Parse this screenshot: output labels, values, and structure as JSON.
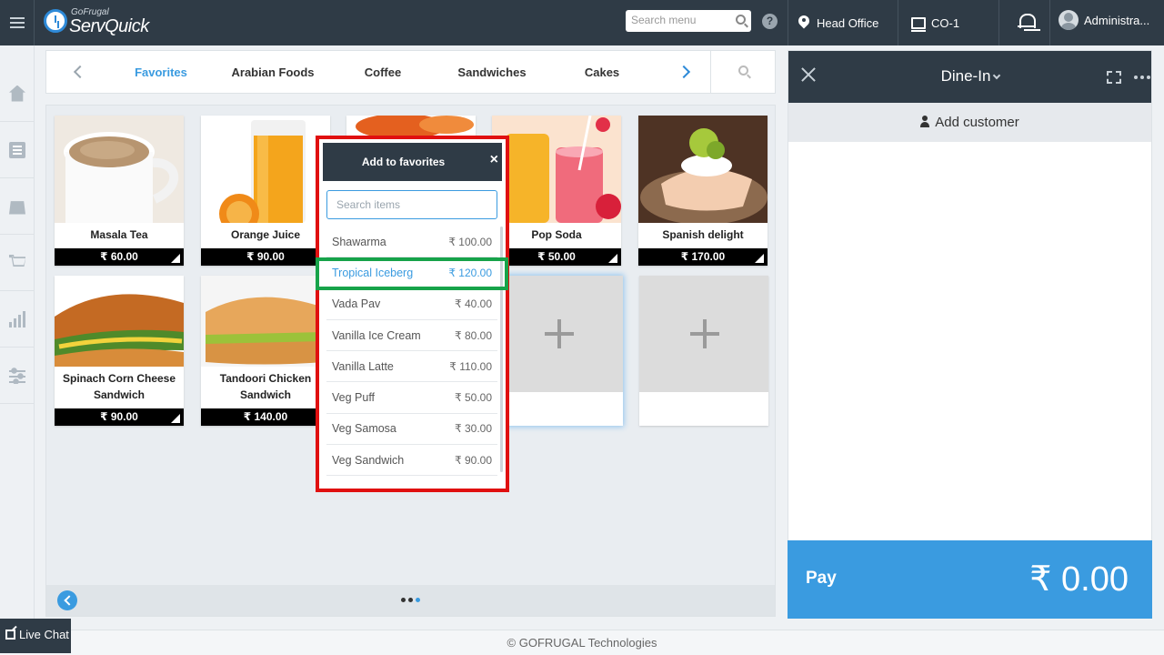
{
  "topbar": {
    "brand_small": "GoFrugal",
    "brand_big": "ServQuick",
    "search_placeholder": "Search menu",
    "location": "Head Office",
    "counter": "CO-1",
    "user": "Administra..."
  },
  "categories": {
    "items": [
      "Favorites",
      "Arabian Foods",
      "Coffee",
      "Sandwiches",
      "Cakes"
    ],
    "active": "Favorites"
  },
  "favorites": [
    {
      "name": "Masala Tea",
      "price": "₹ 60.00"
    },
    {
      "name": "Orange Juice",
      "price": "₹ 90.00"
    },
    {
      "name": "Pop Soda",
      "price": "₹ 50.00"
    },
    {
      "name": "Spanish delight",
      "price": "₹ 170.00"
    },
    {
      "name": "Spinach Corn Cheese Sandwich",
      "price": "₹ 90.00"
    },
    {
      "name": "Tandoori Chicken Sandwich",
      "price": "₹ 140.00"
    }
  ],
  "popup": {
    "title": "Add to favorites",
    "close": "×",
    "search_placeholder": "Search items",
    "items": [
      {
        "name": "Shawarma",
        "price": "₹ 100.00"
      },
      {
        "name": "Tropical Iceberg",
        "price": "₹ 120.00"
      },
      {
        "name": "Vada Pav",
        "price": "₹ 40.00"
      },
      {
        "name": "Vanilla Ice Cream",
        "price": "₹ 80.00"
      },
      {
        "name": "Vanilla Latte",
        "price": "₹ 110.00"
      },
      {
        "name": "Veg Puff",
        "price": "₹ 50.00"
      },
      {
        "name": "Veg Samosa",
        "price": "₹ 30.00"
      },
      {
        "name": "Veg Sandwich",
        "price": "₹ 90.00"
      }
    ],
    "highlighted": "Tropical Iceberg"
  },
  "order": {
    "mode": "Dine-In",
    "add_customer": "Add customer",
    "pay_label": "Pay",
    "total": "₹ 0.00"
  },
  "footer": {
    "copyright": "© GOFRUGAL Technologies",
    "live_chat": "Live Chat"
  },
  "colors": {
    "topbar": "#2f3b46",
    "accent": "#3a9be0",
    "popup_border": "#e01010",
    "highlight_border": "#17a34a"
  }
}
